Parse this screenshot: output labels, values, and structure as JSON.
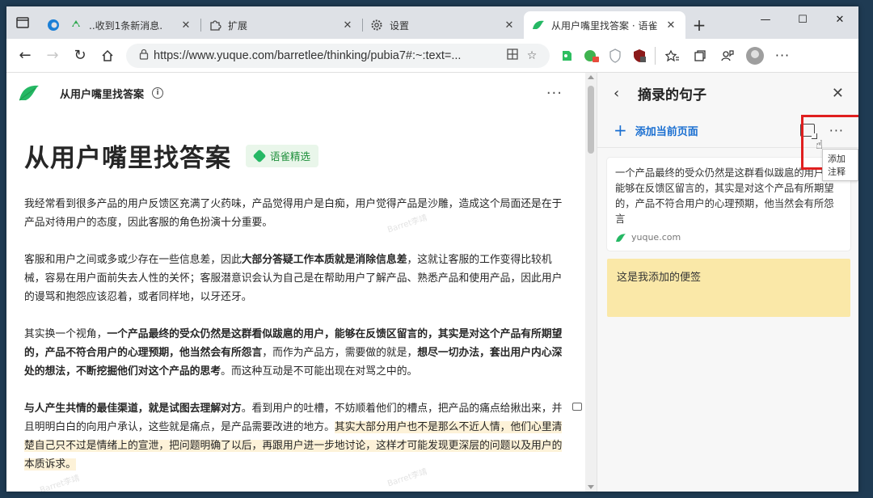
{
  "browser": {
    "tabs": [
      {
        "title": "..收到1条新消息.",
        "icon": "wechat-icon",
        "active": false
      },
      {
        "title": "扩展",
        "icon": "puzzle-icon",
        "active": false
      },
      {
        "title": "设置",
        "icon": "gear-icon",
        "active": false
      },
      {
        "title": "从用户嘴里找答案 · 语雀",
        "icon": "yuque-icon",
        "active": true
      }
    ],
    "address": "https://www.yuque.com/barretlee/thinking/pubia7#:~:text=...",
    "colors": {
      "accent": "#1a6fd1",
      "brand_green": "#25b864",
      "highlight": "#fdf2d8",
      "note": "#fae8a8",
      "callout_red": "#e01f1f"
    }
  },
  "page": {
    "doc_name": "从用户嘴里找答案",
    "title": "从用户嘴里找答案",
    "badge": "语雀精选",
    "watermark": "Barret李靖",
    "paragraphs": {
      "p1": "我经常看到很多产品的用户反馈区充满了火药味，产品觉得用户是白痴，用户觉得产品是沙雕，造成这个局面还是在于产品对待用户的态度，因此客服的角色扮演十分重要。",
      "p2a": "客服和用户之间或多或少存在一些信息差，因此",
      "p2b": "大部分答疑工作本质就是消除信息差",
      "p2c": "，这就让客服的工作变得比较机械，容易在用户面前失去人性的关怀；客服潜意识会认为自己是在帮助用户了解产品、熟悉产品和使用产品，因此用户的谩骂和抱怨应该忍着，或者同样地，以牙还牙。",
      "p3a": "其实换一个视角，",
      "p3b": "一个产品最终的受众仍然是这群看似跋扈的用户，能够在反馈区留言的，其实是对这个产品有所期望的，产品不符合用户的心理预期，他当然会有所怨言",
      "p3c": "，而作为产品方，需要做的就是，",
      "p3d": "想尽一切办法，套出用户内心深处的想法，不断挖掘他们对这个产品的思考",
      "p3e": "。而这种互动是不可能出现在对骂之中的。",
      "p4a": "与人产生共情的最佳渠道，就是试图去理解对方",
      "p4b": "。看到用户的吐槽，不妨顺着他们的槽点，把产品的痛点给揪出来，并且明明白白的向用户承认，这些就是痛点，是产品需要改进的地方。",
      "p4c": "其实大部分用户也不是那么不近人情，他们心里清楚自己只不过是情绪上的宣泄，把问题明确了以后，再跟用户进一步地讨论，这样才可能发现更深层的问题以及用户的本质诉求。"
    }
  },
  "sidepanel": {
    "title": "摘录的句子",
    "add_label": "添加当前页面",
    "tooltip": "添加注释",
    "quote": "一个产品最终的受众仍然是这群看似跋扈的用户，能够在反馈区留言的，其实是对这个产品有所期望的，产品不符合用户的心理预期，他当然会有所怨言",
    "quote_source": "yuque.com",
    "note": "这是我添加的便签"
  }
}
